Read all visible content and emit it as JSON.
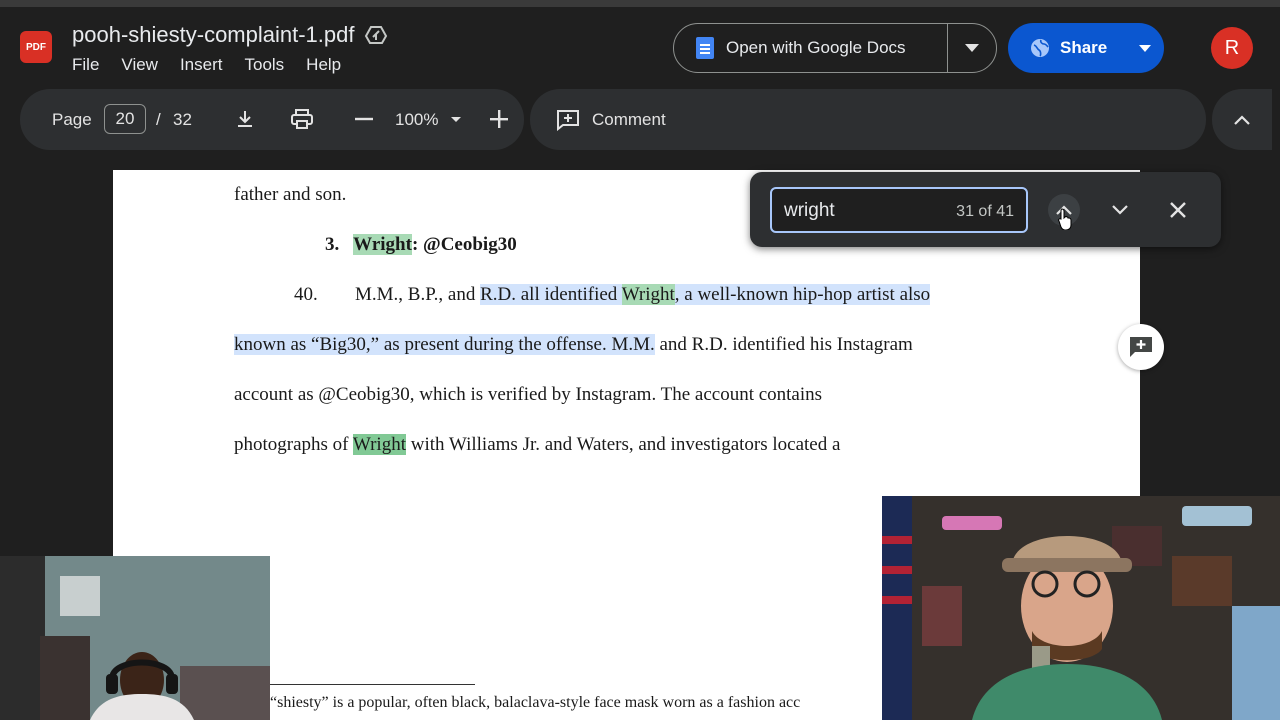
{
  "header": {
    "logo_text": "PDF",
    "file_name": "pooh-shiesty-complaint-1.pdf",
    "menu": [
      "File",
      "View",
      "Insert",
      "Tools",
      "Help"
    ],
    "open_with_label": "Open with Google Docs",
    "share_label": "Share",
    "avatar_initial": "R"
  },
  "toolbar": {
    "page_label": "Page",
    "page_current": "20",
    "page_separator": "/",
    "page_total": "32",
    "zoom_level": "100%",
    "comment_label": "Comment"
  },
  "document": {
    "line1": "father and son.",
    "heading_number": "3.",
    "heading_match": "Wright",
    "heading_rest": ": @Ceobig30",
    "para_number": "40.",
    "p_l1_a": "M.M., B.P., and ",
    "p_l1_b": "R.D. all identified ",
    "p_l1_match": "Wright",
    "p_l1_c": ", a well-known hip-hop artist also",
    "p_l2_a": "known as “Big30,” as present during the offense. M.M.",
    "p_l2_b": " and R.D. identified his Instagram",
    "p_l3": "account as @Ceobig30, which is verified by Instagram. The account contains",
    "p_l4_a": "photographs of ",
    "p_l4_match": "Wright",
    "p_l4_b": " with Williams Jr. and Waters, and investigators located a",
    "footnote": "“shiesty” is a popular, often black, balaclava-style face mask worn as a fashion acc"
  },
  "find": {
    "query": "wright",
    "count": "31 of 41"
  },
  "colors": {
    "background": "#1f1f1f",
    "toolbar": "#2d2f31",
    "share": "#0b57d0",
    "avatar": "#d93025",
    "selection": "#d2e3fc",
    "match": "#a8dab5"
  },
  "icons": [
    "pdf-logo",
    "drive-icon",
    "docs-icon",
    "globe-icon",
    "chevron-down-icon",
    "download-icon",
    "print-icon",
    "minus-icon",
    "plus-icon",
    "comment-icon",
    "chevron-up-icon",
    "close-icon",
    "add-comment-icon",
    "cursor-icon"
  ]
}
